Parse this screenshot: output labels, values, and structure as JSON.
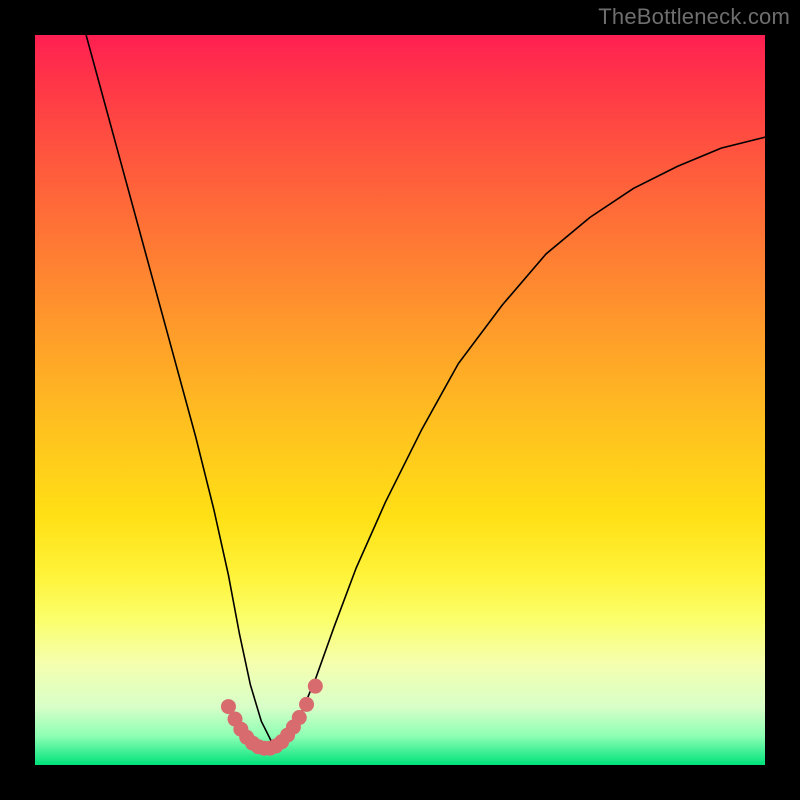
{
  "watermark": "TheBottleneck.com",
  "chart_data": {
    "type": "line",
    "title": "",
    "xlabel": "",
    "ylabel": "",
    "xlim": [
      0,
      100
    ],
    "ylim": [
      0,
      100
    ],
    "series": [
      {
        "name": "bottleneck-curve",
        "x": [
          7,
          10,
          13,
          16,
          19,
          22,
          24.5,
          26.5,
          28,
          29.5,
          31,
          32.5,
          34,
          36,
          38.5,
          41,
          44,
          48,
          53,
          58,
          64,
          70,
          76,
          82,
          88,
          94,
          100
        ],
        "values": [
          100,
          89,
          78,
          67,
          56,
          45,
          35,
          26,
          18,
          11,
          6,
          3,
          3,
          6,
          12,
          19,
          27,
          36,
          46,
          55,
          63,
          70,
          75,
          79,
          82,
          84.5,
          86
        ]
      }
    ],
    "markers": {
      "name": "highlight-dots",
      "color": "#d86b6e",
      "x": [
        26.5,
        27.4,
        28.2,
        29.0,
        29.8,
        30.6,
        31.4,
        32.2,
        33.0,
        33.8,
        34.6,
        35.4,
        36.2,
        37.2,
        38.4
      ],
      "values": [
        8.0,
        6.3,
        4.9,
        3.8,
        3.0,
        2.5,
        2.3,
        2.3,
        2.6,
        3.2,
        4.1,
        5.2,
        6.5,
        8.3,
        10.8
      ]
    },
    "grid": false,
    "legend": false
  }
}
